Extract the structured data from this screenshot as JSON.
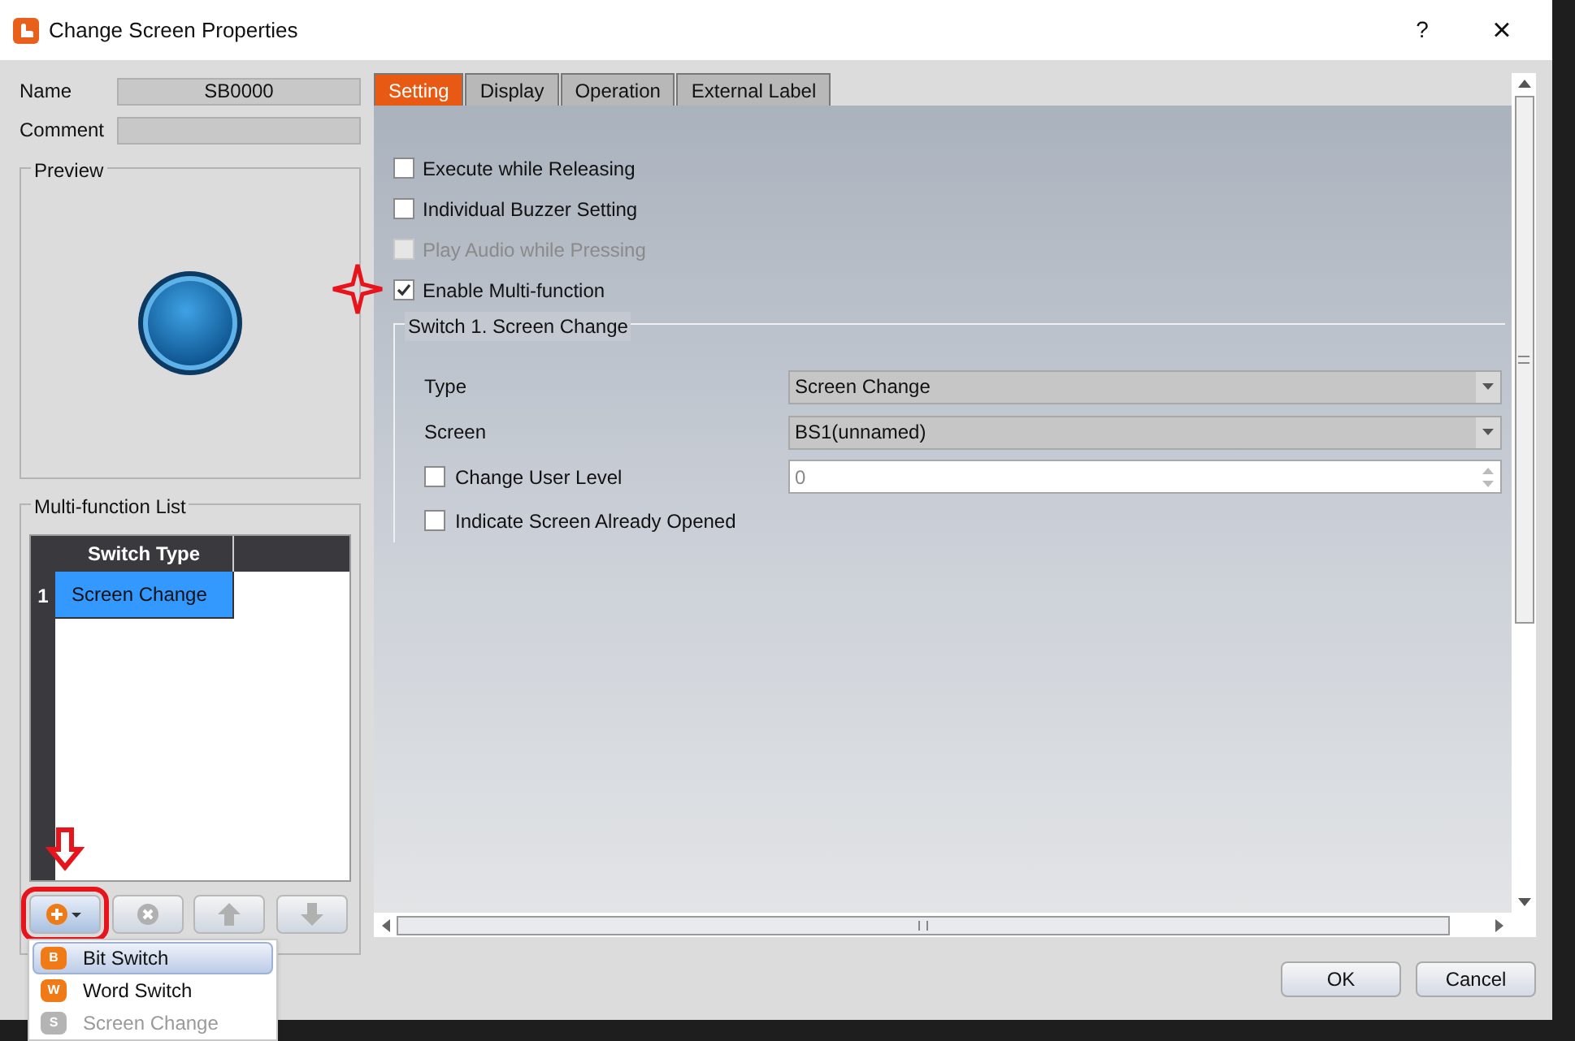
{
  "window": {
    "title": "Change Screen Properties",
    "help": "?",
    "close": "×"
  },
  "fields": [
    {
      "label": "Name",
      "value": "SB0000"
    },
    {
      "label": "Comment"
    }
  ],
  "preview": {
    "title": "Preview"
  },
  "multi_function_list": {
    "title": "Multi-function List",
    "columns": [
      "Switch Type"
    ],
    "rows": [
      {
        "index": "1",
        "cells": [
          "Screen Change"
        ],
        "selected": true
      }
    ],
    "buttons": [
      {
        "kind": "add",
        "disabled": false,
        "highlighted": true
      },
      {
        "kind": "remove",
        "disabled": true,
        "highlighted": false
      },
      {
        "kind": "up",
        "disabled": true,
        "highlighted": false
      },
      {
        "kind": "down",
        "disabled": true,
        "highlighted": false
      }
    ]
  },
  "add_menu": [
    {
      "label": "Bit Switch",
      "icon": "B",
      "selected": true,
      "disabled": false
    },
    {
      "label": "Word Switch",
      "icon": "W",
      "selected": false,
      "disabled": false
    },
    {
      "label": "Screen Change",
      "icon": "S",
      "selected": false,
      "disabled": true
    }
  ],
  "tabs": [
    {
      "label": "Setting",
      "selected": true
    },
    {
      "label": "Display",
      "selected": false
    },
    {
      "label": "Operation",
      "selected": false
    },
    {
      "label": "External Label",
      "selected": false
    }
  ],
  "options": [
    {
      "label": "Execute while Releasing",
      "checked": false,
      "disabled": false
    },
    {
      "label": "Individual Buzzer Setting",
      "checked": false,
      "disabled": false
    },
    {
      "label": "Play Audio while Pressing",
      "checked": false,
      "disabled": true
    },
    {
      "label": "Enable Multi-function",
      "checked": true,
      "disabled": false,
      "marked": true
    }
  ],
  "switch_group": {
    "title": "Switch 1. Screen Change",
    "rows": [
      {
        "kind": "select",
        "label": "Type",
        "value": "Screen Change"
      },
      {
        "kind": "select",
        "label": "Screen",
        "value": "BS1(unnamed)"
      },
      {
        "kind": "checkspin",
        "label": "Change User Level",
        "checked": false,
        "value": "0",
        "disabled": true
      },
      {
        "kind": "check",
        "label": "Indicate Screen Already Opened",
        "checked": false
      }
    ]
  },
  "buttons": [
    "OK",
    "Cancel"
  ]
}
